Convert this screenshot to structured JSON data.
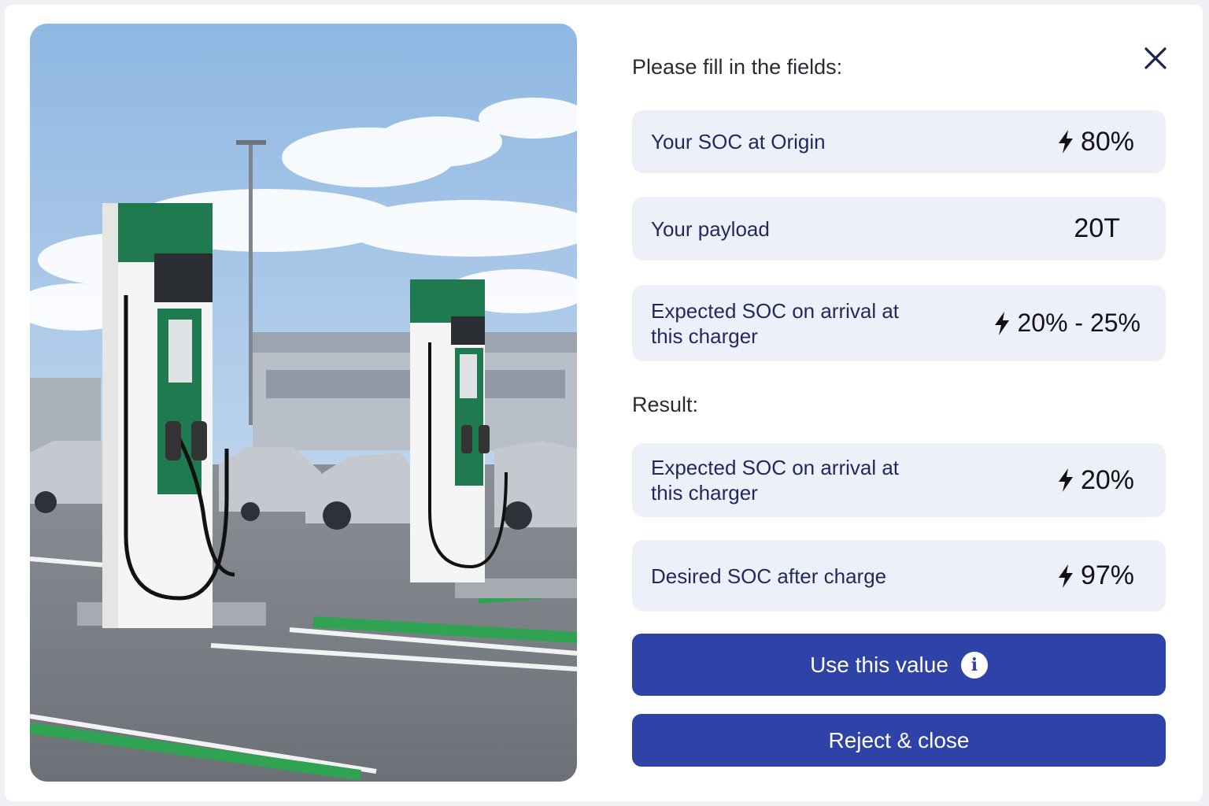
{
  "panel": {
    "title": "Please fill in the fields:",
    "close_icon": "close-icon"
  },
  "fields": [
    {
      "label": "Your SOC at Origin",
      "value": "80%",
      "icon": "bolt-icon"
    },
    {
      "label": "Your payload",
      "value": "20T",
      "icon": null
    },
    {
      "label": "Expected SOC on arrival at this charger",
      "value": "20% - 25%",
      "icon": "bolt-icon"
    }
  ],
  "result": {
    "label": "Result:",
    "fields": [
      {
        "label": "Expected SOC on arrival at this charger",
        "value": "20%",
        "icon": "bolt-icon"
      },
      {
        "label": "Desired SOC after charge",
        "value": "97%",
        "icon": "bolt-icon"
      }
    ]
  },
  "buttons": {
    "use_label": "Use this value",
    "use_icon": "info-icon",
    "info_glyph": "i",
    "reject_label": "Reject & close"
  },
  "image": {
    "subject": "ev-charging-stations-photo"
  },
  "colors": {
    "primary": "#2e42a8",
    "field_bg": "#eef0f9",
    "charger_green": "#1f7a4f"
  }
}
